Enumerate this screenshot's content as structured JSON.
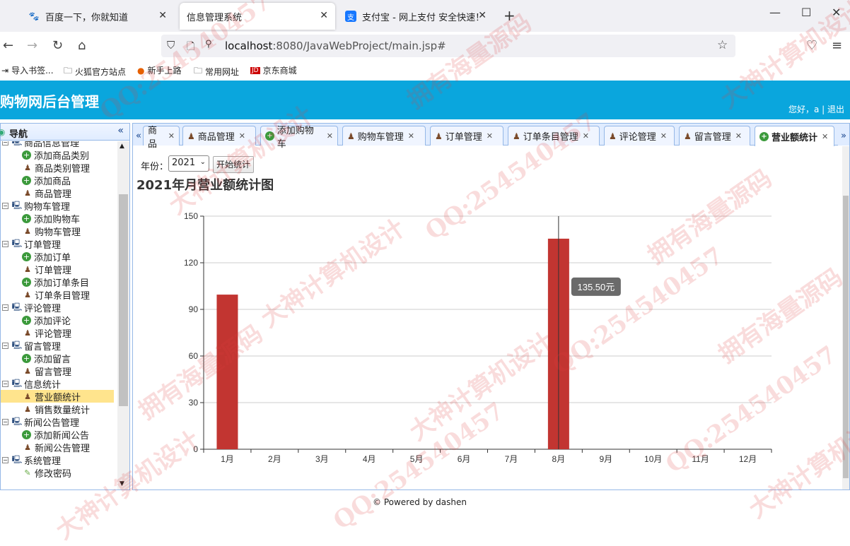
{
  "browser": {
    "tabs": [
      {
        "title": "百度一下，你就知道"
      },
      {
        "title": "信息管理系统"
      },
      {
        "title": "支付宝 - 网上支付 安全快速！"
      }
    ],
    "url_host": "localhost",
    "url_rest": ":8080/JavaWebProject/main.jsp#",
    "bookmarks": [
      "导入书签...",
      "火狐官方站点",
      "新手上路",
      "常用网址",
      "京东商城"
    ]
  },
  "app": {
    "title": "购物网后台管理",
    "greeting": "您好，a",
    "logout": "退出"
  },
  "nav": {
    "title": "导航",
    "groups": [
      {
        "label": "商品信息管理",
        "items": [
          "添加商品类别",
          "商品类别管理",
          "添加商品",
          "商品管理"
        ]
      },
      {
        "label": "购物车管理",
        "items": [
          "添加购物车",
          "购物车管理"
        ]
      },
      {
        "label": "订单管理",
        "items": [
          "添加订单",
          "订单管理",
          "添加订单条目",
          "订单条目管理"
        ]
      },
      {
        "label": "评论管理",
        "items": [
          "添加评论",
          "评论管理"
        ]
      },
      {
        "label": "留言管理",
        "items": [
          "添加留言",
          "留言管理"
        ]
      },
      {
        "label": "信息统计",
        "items": [
          "营业额统计",
          "销售数量统计"
        ]
      },
      {
        "label": "新闻公告管理",
        "items": [
          "添加新闻公告",
          "新闻公告管理"
        ]
      },
      {
        "label": "系统管理",
        "items": [
          "修改密码"
        ]
      }
    ],
    "selected": "营业额统计"
  },
  "tabs": [
    "商品",
    "商品管理",
    "添加购物车",
    "购物车管理",
    "订单管理",
    "订单条目管理",
    "评论管理",
    "留言管理",
    "营业额统计"
  ],
  "form": {
    "year_label": "年份：",
    "year_value": "2021",
    "start_button": "开始统计"
  },
  "tooltip": "135.50元",
  "footer": "© Powered by dashen",
  "watermarks": [
    "QQ:254540457",
    "大神计算机设计",
    "拥有海量源码"
  ],
  "chart_data": {
    "type": "bar",
    "title": "2021年月营业额统计图",
    "categories": [
      "1月",
      "2月",
      "3月",
      "4月",
      "5月",
      "6月",
      "7月",
      "8月",
      "9月",
      "10月",
      "11月",
      "12月"
    ],
    "values": [
      99.5,
      0,
      0,
      0,
      0,
      0,
      0,
      135.5,
      0,
      0,
      0,
      0
    ],
    "ylim": [
      0,
      150
    ],
    "yticks": [
      0,
      30,
      60,
      90,
      120,
      150
    ],
    "color": "#c23531",
    "grid": true
  }
}
